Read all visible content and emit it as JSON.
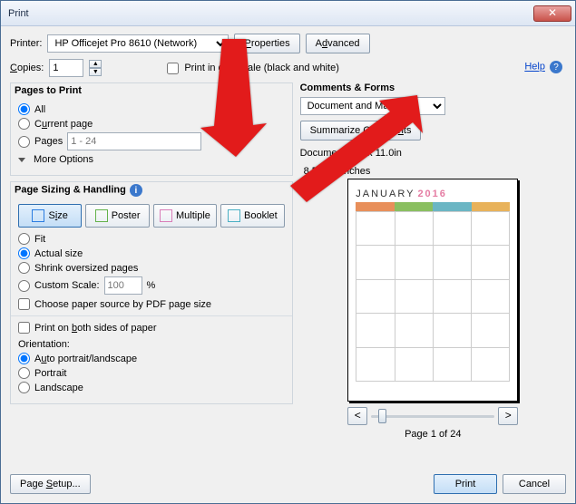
{
  "window": {
    "title": "Print"
  },
  "top": {
    "printer_label": "Printer:",
    "printer_value": "HP Officejet Pro 8610 (Network)",
    "properties_btn": "Properties",
    "advanced_btn": "Advanced",
    "help_label": "Help",
    "copies_label": "Copies:",
    "copies_value": "1",
    "grayscale_label": "Print in grayscale (black and white)"
  },
  "pages": {
    "title": "Pages to Print",
    "all": "All",
    "current": "Current page",
    "pages_radio": "Pages",
    "pages_value": "1 - 24",
    "more": "More Options"
  },
  "sizing": {
    "title": "Page Sizing & Handling",
    "size_btn": "Size",
    "poster_btn": "Poster",
    "multiple_btn": "Multiple",
    "booklet_btn": "Booklet",
    "fit": "Fit",
    "actual": "Actual size",
    "shrink": "Shrink oversized pages",
    "custom_scale": "Custom Scale:",
    "scale_value": "100",
    "percent": "%",
    "choose_paper": "Choose paper source by PDF page size",
    "both_sides": "Print on both sides of paper",
    "orientation_label": "Orientation:",
    "auto": "Auto portrait/landscape",
    "portrait": "Portrait",
    "landscape": "Landscape"
  },
  "comments": {
    "title": "Comments & Forms",
    "dropdown": "Document and Markups",
    "summarize_btn": "Summarize Comments",
    "doc_dim": "Document: 8.5 x 11.0in"
  },
  "preview": {
    "size_label": "8.5 x 11 Inches",
    "cal_month": "JANUARY",
    "cal_year": "2016",
    "page_of": "Page 1 of 24",
    "prev": "<",
    "next": ">"
  },
  "bottom": {
    "page_setup": "Page Setup...",
    "print": "Print",
    "cancel": "Cancel"
  }
}
